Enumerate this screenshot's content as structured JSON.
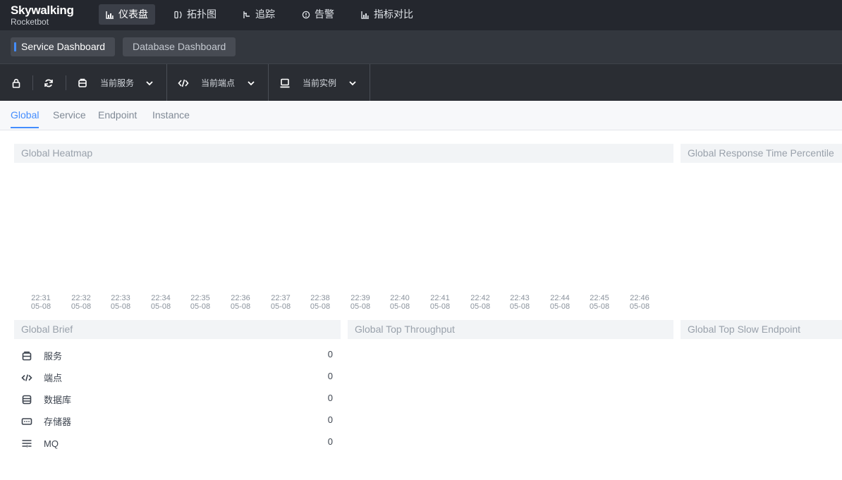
{
  "nav": {
    "brand": "Skywalking",
    "subtitle": "Rocketbot",
    "items": [
      {
        "label": "仪表盘",
        "icon": "bar-chart-icon",
        "active": true
      },
      {
        "label": "拓扑图",
        "icon": "topology-icon",
        "active": false
      },
      {
        "label": "追踪",
        "icon": "trace-icon",
        "active": false
      },
      {
        "label": "告警",
        "icon": "alarm-icon",
        "active": false
      },
      {
        "label": "指标对比",
        "icon": "compare-icon",
        "active": false
      }
    ]
  },
  "dashboards": {
    "tabs": [
      {
        "label": "Service Dashboard",
        "active": true
      },
      {
        "label": "Database Dashboard",
        "active": false
      }
    ]
  },
  "toolbar": {
    "lock_icon": "lock-icon",
    "refresh_icon": "refresh-icon",
    "service_select": {
      "label": "当前服务",
      "icon": "cube-icon"
    },
    "endpoint_select": {
      "label": "当前端点",
      "icon": "code-icon"
    },
    "instance_select": {
      "label": "当前实例",
      "icon": "laptop-icon"
    }
  },
  "subtabs": [
    {
      "label": "Global",
      "active": true
    },
    {
      "label": "Service",
      "active": false
    },
    {
      "label": "Endpoint",
      "active": false
    },
    {
      "label": "Instance",
      "active": false
    }
  ],
  "heatmap": {
    "title": "Global Heatmap",
    "x_ticks": [
      {
        "time": "22:31",
        "date": "05-08"
      },
      {
        "time": "22:32",
        "date": "05-08"
      },
      {
        "time": "22:33",
        "date": "05-08"
      },
      {
        "time": "22:34",
        "date": "05-08"
      },
      {
        "time": "22:35",
        "date": "05-08"
      },
      {
        "time": "22:36",
        "date": "05-08"
      },
      {
        "time": "22:37",
        "date": "05-08"
      },
      {
        "time": "22:38",
        "date": "05-08"
      },
      {
        "time": "22:39",
        "date": "05-08"
      },
      {
        "time": "22:40",
        "date": "05-08"
      },
      {
        "time": "22:41",
        "date": "05-08"
      },
      {
        "time": "22:42",
        "date": "05-08"
      },
      {
        "time": "22:43",
        "date": "05-08"
      },
      {
        "time": "22:44",
        "date": "05-08"
      },
      {
        "time": "22:45",
        "date": "05-08"
      },
      {
        "time": "22:46",
        "date": "05-08"
      }
    ]
  },
  "percentile": {
    "title": "Global Response Time Percentile"
  },
  "brief": {
    "title": "Global Brief",
    "rows": [
      {
        "label": "服务",
        "value": "0",
        "icon": "cube-icon"
      },
      {
        "label": "端点",
        "value": "0",
        "icon": "code-icon"
      },
      {
        "label": "数据库",
        "value": "0",
        "icon": "database-icon"
      },
      {
        "label": "存储器",
        "value": "0",
        "icon": "storage-icon"
      },
      {
        "label": "MQ",
        "value": "0",
        "icon": "mq-icon"
      }
    ]
  },
  "throughput": {
    "title": "Global Top Throughput"
  },
  "slow_endpoint": {
    "title": "Global Top Slow Endpoint"
  }
}
